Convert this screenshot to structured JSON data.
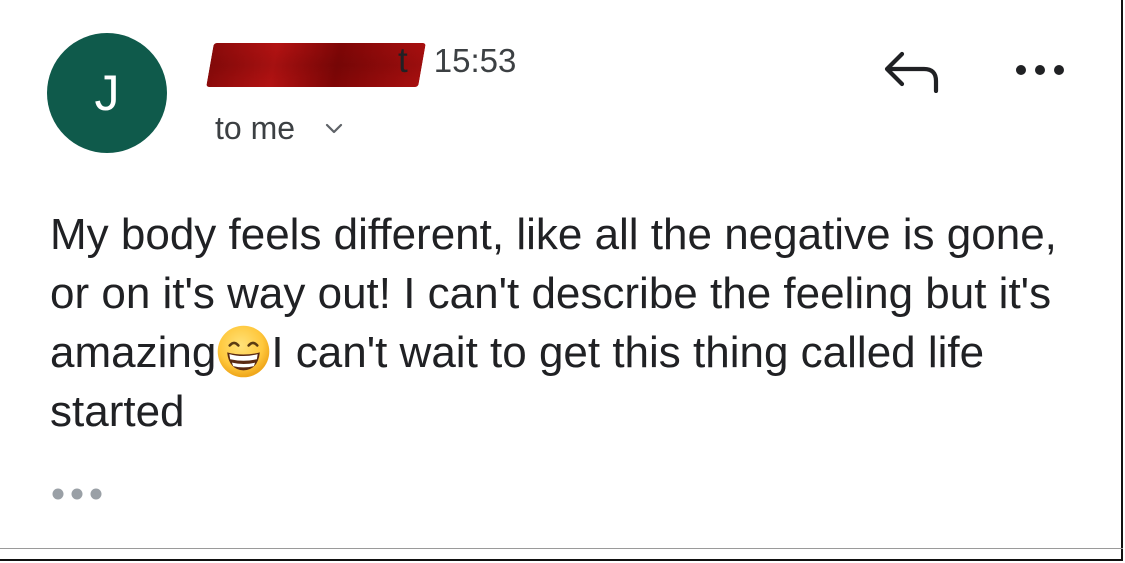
{
  "avatar": {
    "letter": "J",
    "color": "#0f5a4b"
  },
  "header": {
    "sender_visible": "t",
    "sender_redacted": true,
    "time": "15:53",
    "recipient": "to me"
  },
  "actions": {
    "reply_icon": "reply-arrow-icon",
    "more_icon": "more-horizontal-icon"
  },
  "message": {
    "part1": "My body feels different, like all the negative is gone, or on it's way out! I can't describe the feeling but it's amazing",
    "emoji": "grinning-face-with-smiling-eyes",
    "part2": "I can't wait to get this thing called life started"
  },
  "footer": {
    "trimmed_content_icon": "ellipsis-icon"
  }
}
